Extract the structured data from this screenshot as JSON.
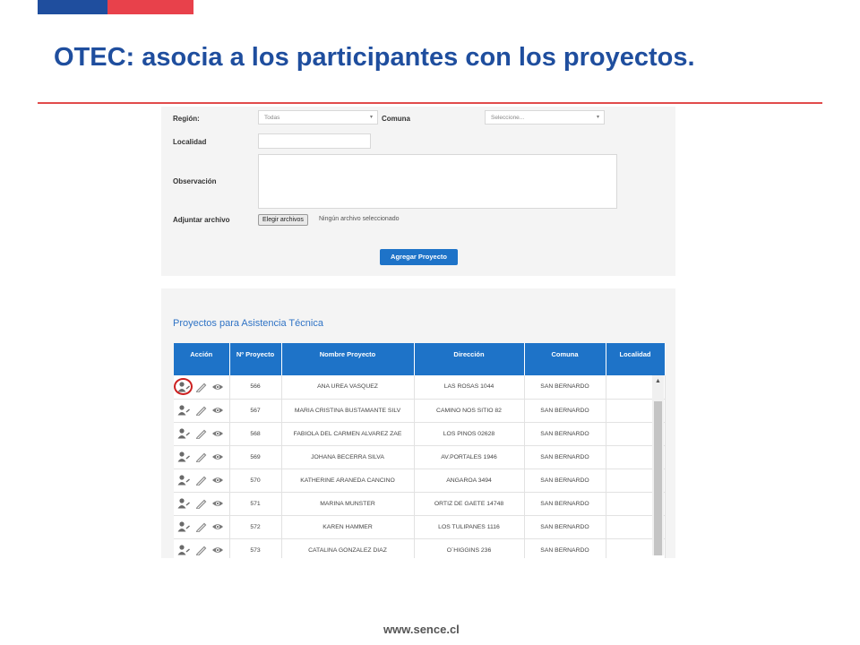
{
  "title": "OTEC: asocia a los participantes con los proyectos.",
  "colors": {
    "brand_blue": "#1f4e9e",
    "brand_red": "#e8414b",
    "ui_blue": "#1e73c8"
  },
  "form": {
    "region_label": "Región:",
    "region_value": "Todas",
    "comuna_label": "Comuna",
    "comuna_placeholder": "Seleccione...",
    "localidad_label": "Localidad",
    "observacion_label": "Observación",
    "adjuntar_label": "Adjuntar archivo",
    "file_button": "Elegir archivos",
    "file_none": "Ningún archivo seleccionado",
    "add_button": "Agregar Proyecto"
  },
  "projects": {
    "section_title": "Proyectos para Asistencia Técnica",
    "columns": [
      "Acción",
      "Nº Proyecto",
      "Nombre Proyecto",
      "Dirección",
      "Comuna",
      "Localidad"
    ],
    "action_icons": [
      "user-add-icon",
      "pencil-icon",
      "eye-icon"
    ],
    "rows": [
      {
        "num": "566",
        "name": "ANA UREA VASQUEZ",
        "dir": "LAS ROSAS  1044",
        "comuna": "SAN BERNARDO",
        "localidad": ""
      },
      {
        "num": "567",
        "name": "MARIA CRISTINA BUSTAMANTE SILV",
        "dir": "CAMINO NOS SITIO 82",
        "comuna": "SAN BERNARDO",
        "localidad": ""
      },
      {
        "num": "568",
        "name": "FABIOLA DEL CARMEN ALVAREZ ZAE",
        "dir": "LOS PINOS  02628",
        "comuna": "SAN BERNARDO",
        "localidad": ""
      },
      {
        "num": "569",
        "name": "JOHANA BECERRA SILVA",
        "dir": "AV.PORTALES 1946",
        "comuna": "SAN BERNARDO",
        "localidad": ""
      },
      {
        "num": "570",
        "name": "KATHERINE ARANEDA CANCINO",
        "dir": "ANGAROA  3494",
        "comuna": "SAN BERNARDO",
        "localidad": ""
      },
      {
        "num": "571",
        "name": "MARINA MUNSTER",
        "dir": "ORTIZ DE GAETE 14748",
        "comuna": "SAN BERNARDO",
        "localidad": ""
      },
      {
        "num": "572",
        "name": "KAREN HAMMER",
        "dir": "LOS TULIPANES 1116",
        "comuna": "SAN BERNARDO",
        "localidad": ""
      },
      {
        "num": "573",
        "name": "CATALINA GONZALEZ DIAZ",
        "dir": "O´HIGGINS  236",
        "comuna": "SAN BERNARDO",
        "localidad": ""
      }
    ]
  },
  "footer_url": "www.sence.cl"
}
